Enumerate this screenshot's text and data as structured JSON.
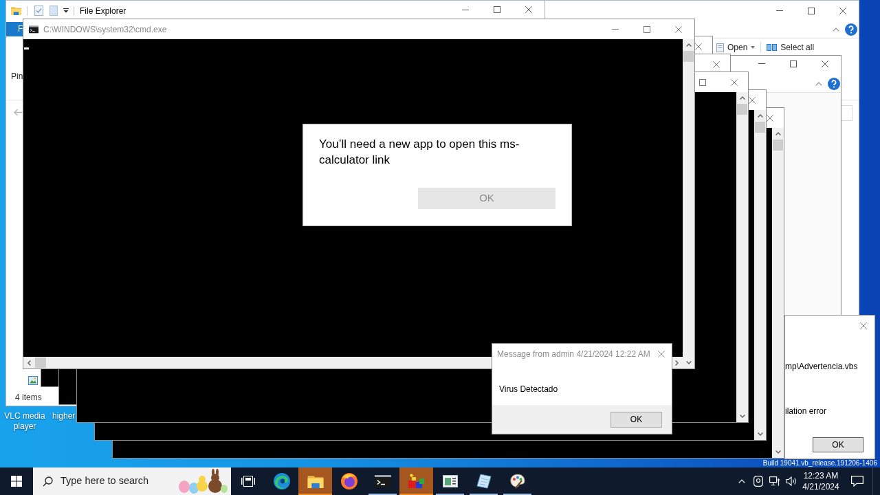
{
  "desktop_icons": [
    {
      "label": "VLC media player"
    },
    {
      "label": "higher"
    }
  ],
  "file_explorer": {
    "title": "File Explorer",
    "title_buttons": [
      {
        "kind": "minimize"
      },
      {
        "kind": "maximize"
      },
      {
        "kind": "close"
      }
    ],
    "ribbon_tab": "F",
    "ribbon_command": "Pin",
    "status": "4 items"
  },
  "second_explorer": {
    "title_buttons": [
      {
        "kind": "minimize"
      },
      {
        "kind": "maximize"
      },
      {
        "kind": "close"
      }
    ],
    "ribbon_buttons": [
      {
        "label": "Open",
        "kind": "dropdown"
      },
      {
        "label": "Select all",
        "kind": "plain"
      }
    ]
  },
  "third_explorer": {
    "title_buttons": [
      {
        "kind": "minimize"
      },
      {
        "kind": "maximize"
      },
      {
        "kind": "close"
      }
    ]
  },
  "error_dialog": {
    "lines": [
      "mp\\Advertencia.vbs",
      "ilation error"
    ],
    "button": "OK"
  },
  "consoles": [
    {
      "title": "C:\\WINDOWS\\system32\\cmd.exe",
      "focused": false,
      "cursor": true,
      "title_buttons": [
        {
          "kind": "minimize"
        },
        {
          "kind": "maximize"
        },
        {
          "kind": "close"
        }
      ],
      "scrollbars": [
        {
          "kind": "vertical"
        },
        {
          "kind": "horizontal"
        }
      ]
    },
    {
      "focused": false,
      "title_buttons": [
        {
          "kind": "close"
        }
      ]
    },
    {
      "focused": false,
      "title_buttons": [
        {
          "kind": "close"
        }
      ]
    },
    {
      "focused": false,
      "title_buttons": [
        {
          "kind": "maximize"
        },
        {
          "kind": "close"
        }
      ],
      "scrollbars": [
        {
          "kind": "vertical"
        }
      ]
    },
    {
      "focused": false,
      "title_buttons": [
        {
          "kind": "close"
        }
      ],
      "scrollbars": [
        {
          "kind": "vertical"
        }
      ]
    },
    {
      "focused": false,
      "title_buttons": [
        {
          "kind": "close"
        }
      ],
      "scrollbars": [
        {
          "kind": "vertical"
        }
      ]
    }
  ],
  "message_box": {
    "title": "Message from admin 4/21/2024 12:22 AM",
    "focused": false,
    "message": "Virus Detectado",
    "button": "OK"
  },
  "app_dialog": {
    "message": "You’ll need a new app to open this ms-calculator link",
    "button": {
      "label": "OK",
      "disabled": true
    }
  },
  "build_info": "Build 19041.vb_release.191206-1406",
  "taskbar": {
    "search": {
      "placeholder": "Type here to search"
    },
    "apps": [
      {
        "kind": "task_view",
        "running": false,
        "attention": false
      },
      {
        "kind": "swirl",
        "running": false,
        "attention": false
      },
      {
        "kind": "folder",
        "running": true,
        "attention": true
      },
      {
        "kind": "ring",
        "running": false,
        "attention": false
      },
      {
        "kind": "console",
        "running": true,
        "attention": false
      },
      {
        "kind": "shapes",
        "running": true,
        "attention": true
      },
      {
        "kind": "window",
        "running": true,
        "attention": false
      },
      {
        "kind": "page",
        "running": true,
        "attention": false
      },
      {
        "kind": "palette",
        "running": true,
        "attention": false
      }
    ],
    "time": "12:23 AM",
    "date": "4/21/2024"
  }
}
